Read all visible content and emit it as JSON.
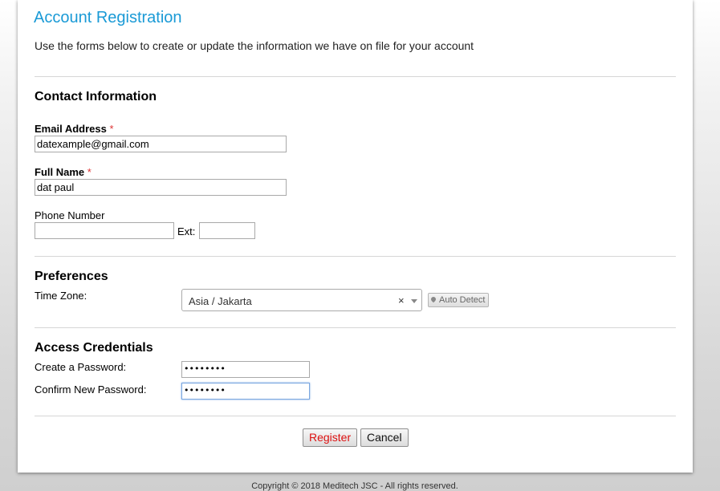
{
  "header": {
    "title": "Account Registration",
    "subtitle": "Use the forms below to create or update the information we have on file for your account"
  },
  "contact": {
    "section_title": "Contact Information",
    "email_label": "Email Address",
    "email_value": "datexample@gmail.com",
    "fullname_label": "Full Name",
    "fullname_value": "dat paul",
    "phone_label": "Phone Number",
    "phone_value": "",
    "ext_label": "Ext:",
    "ext_value": "",
    "required_marker": "*"
  },
  "preferences": {
    "section_title": "Preferences",
    "timezone_label": "Time Zone:",
    "timezone_value": "Asia / Jakarta",
    "clear_symbol": "×",
    "auto_detect_label": "Auto Detect"
  },
  "credentials": {
    "section_title": "Access Credentials",
    "password_label": "Create a Password:",
    "password_masked": "••••••••",
    "confirm_label": "Confirm New Password:",
    "confirm_masked": "••••••••"
  },
  "actions": {
    "register_label": "Register",
    "cancel_label": "Cancel"
  },
  "footer": {
    "copyright": "Copyright © 2018 Meditech JSC - All rights reserved."
  },
  "colors": {
    "title": "#1a9ad6",
    "required": "#dd3333",
    "register_text": "#dd1111"
  }
}
